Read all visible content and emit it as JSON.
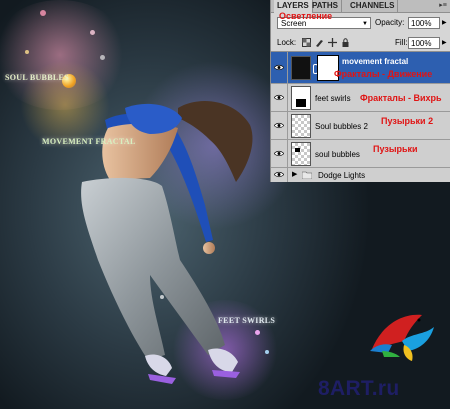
{
  "artwork": {
    "labels": {
      "soul_bubbles": "SOUL BUBBLES",
      "movement_fractal": "MOVEMENT FRACTAL",
      "feet_swirls": "FEET SWIRLS"
    }
  },
  "layers_panel": {
    "tabs": [
      "LAYERS",
      "PATHS",
      "CHANNELS"
    ],
    "active_tab": "LAYERS",
    "blend_mode": "Screen",
    "blend_mode_annotation": "Осветление",
    "opacity_label": "Opacity:",
    "opacity_value": "100%",
    "lock_label": "Lock:",
    "fill_label": "Fill:",
    "fill_value": "100%",
    "layers": [
      {
        "name": "movement fractal",
        "annotation": "Фракталы - Движение",
        "selected": true,
        "visible": true,
        "has_mask": true
      },
      {
        "name": "feet swirls",
        "annotation": "Фракталы - Вихрь",
        "selected": false,
        "visible": true
      },
      {
        "name": "Soul bubbles 2",
        "annotation": "Пузырьки 2",
        "selected": false,
        "visible": true
      },
      {
        "name": "soul bubbles",
        "annotation": "Пузырьки",
        "selected": false,
        "visible": true
      },
      {
        "name": "Dodge Lights",
        "annotation": "",
        "selected": false,
        "visible": true,
        "is_group": true
      }
    ]
  },
  "watermark": {
    "text": "8ART.ru"
  },
  "colors": {
    "selection": "#2d5fb0",
    "annotation_red": "#e01414",
    "watermark_navy": "#1e1e64"
  }
}
